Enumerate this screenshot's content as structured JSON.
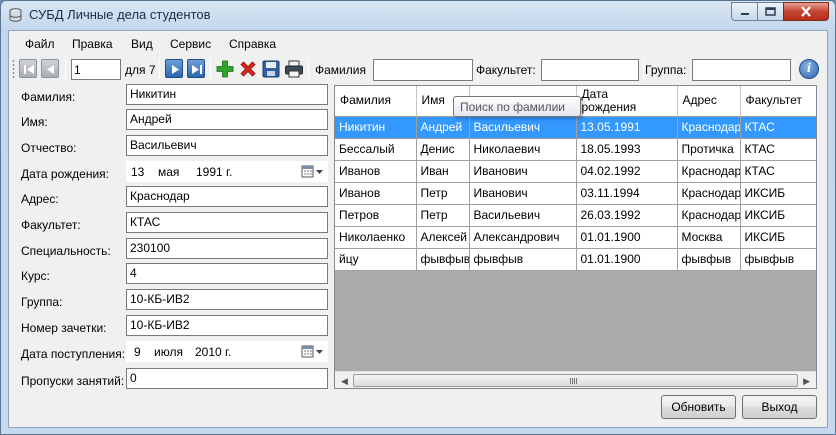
{
  "window": {
    "title": "СУБД Личные дела студентов",
    "icon": "database-icon"
  },
  "menu": [
    "Файл",
    "Правка",
    "Вид",
    "Сервис",
    "Справка"
  ],
  "toolbar": {
    "position": "1",
    "of_label": "для 7",
    "filter_surname_label": "Фамилия",
    "filter_surname_value": "",
    "filter_faculty_label": "Факультет:",
    "filter_faculty_value": "",
    "filter_group_label": "Группа:",
    "filter_group_value": ""
  },
  "form": {
    "surname_label": "Фамилия:",
    "surname": "Никитин",
    "name_label": "Имя:",
    "name": "Андрей",
    "patronymic_label": "Отчество:",
    "patronymic": "Васильевич",
    "birth_label": "Дата рождения:",
    "birth_day": "13",
    "birth_month": "мая",
    "birth_year": "1991 г.",
    "address_label": "Адрес:",
    "address": "Краснодар",
    "faculty_label": "Факультет:",
    "faculty": "КТАС",
    "specialty_label": "Специальность:",
    "specialty": "230100",
    "course_label": "Курс:",
    "course": "4",
    "group_label": "Группа:",
    "group": "10-КБ-ИВ2",
    "record_book_label": "Номер зачетки:",
    "record_book": "10-КБ-ИВ2",
    "admission_label": "Дата поступления:",
    "admission_day": "9",
    "admission_month": "июля",
    "admission_year": "2010 г.",
    "absences_label": "Пропуски занятий:",
    "absences": "0"
  },
  "grid": {
    "columns": [
      "Фамилия",
      "Имя",
      "",
      "Дата\nрождения",
      "Адрес",
      "Факультет"
    ],
    "column_widths": [
      81,
      53,
      107,
      101,
      63,
      76
    ],
    "rows": [
      [
        "Никитин",
        "Андрей",
        "Васильевич",
        "13.05.1991",
        "Краснодар",
        "КТАС"
      ],
      [
        "Бессалый",
        "Денис",
        "Николаевич",
        "18.05.1993",
        "Протичка",
        "КТАС"
      ],
      [
        "Иванов",
        "Иван",
        "Иванович",
        "04.02.1992",
        "Краснодар",
        "КТАС"
      ],
      [
        "Иванов",
        "Петр",
        "Иванович",
        "03.11.1994",
        "Краснодар",
        "ИКСИБ"
      ],
      [
        "Петров",
        "Петр",
        "Васильевич",
        "26.03.1992",
        "Краснодар",
        "ИКСИБ"
      ],
      [
        "Николаенко",
        "Алексей",
        "Александрович",
        "01.01.1900",
        "Москва",
        "ИКСИБ"
      ],
      [
        "йцу",
        "фывфыв",
        "фывфыв",
        "01.01.1900",
        "фывфыв",
        "фывфыв"
      ]
    ],
    "selected_row": 0
  },
  "tooltip": "Поиск по фамилии",
  "buttons": {
    "refresh": "Обновить",
    "exit": "Выход"
  },
  "colors": {
    "selection": "#3399ff",
    "add": "#2ea62e",
    "delete": "#d9261c",
    "nav": "#2b66b1"
  }
}
